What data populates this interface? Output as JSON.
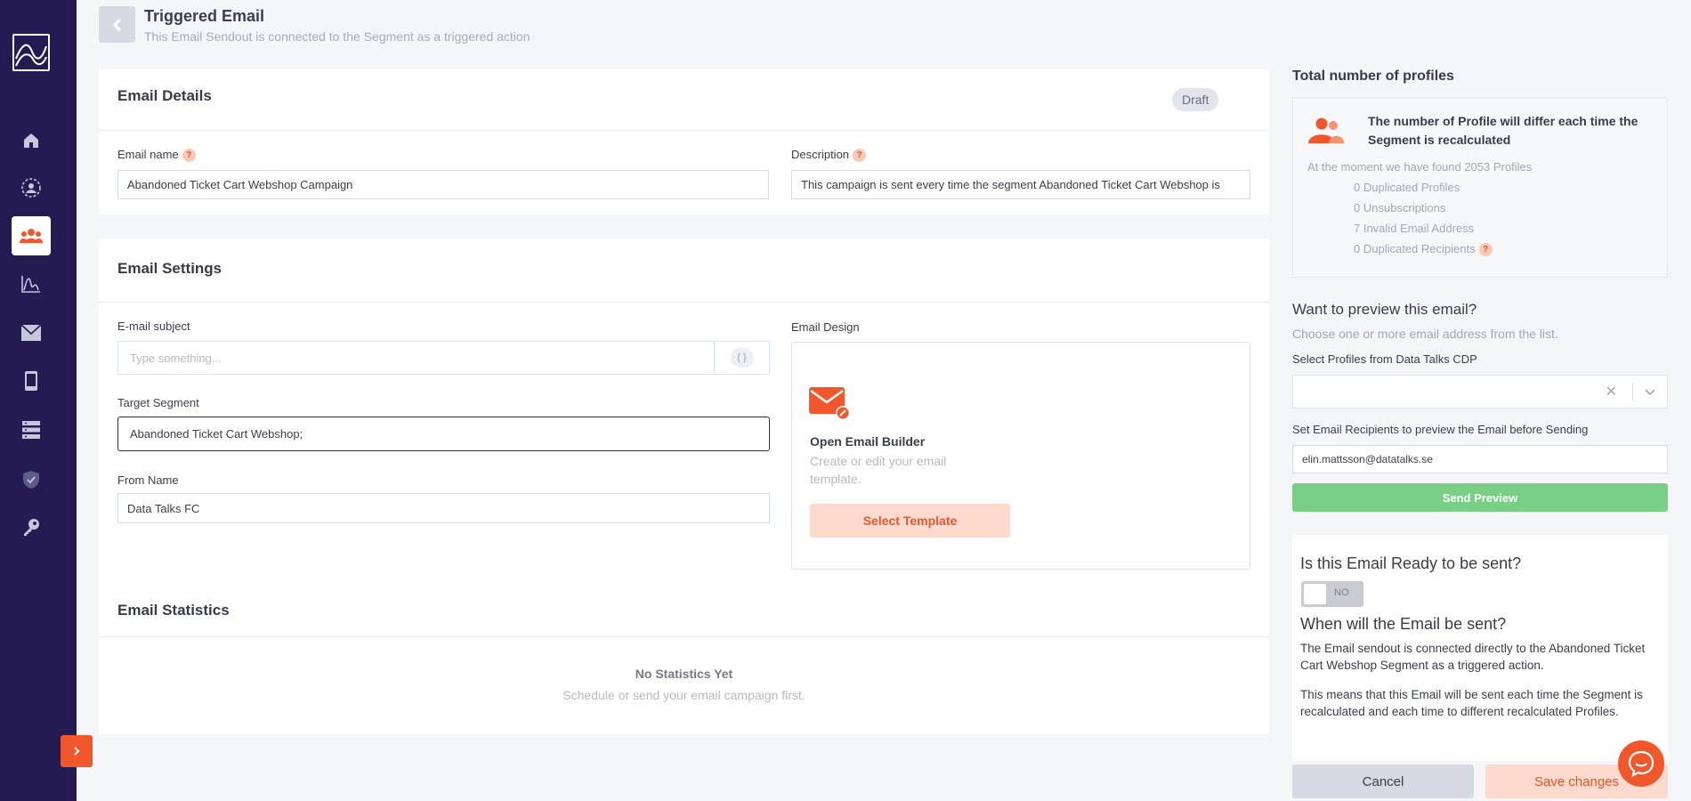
{
  "header": {
    "title": "Triggered Email",
    "subtitle": "This Email Sendout is connected to the Segment as a triggered action"
  },
  "sidebar": {
    "items": [
      {
        "icon": "home-icon"
      },
      {
        "icon": "user-circle-icon"
      },
      {
        "icon": "users-icon"
      },
      {
        "icon": "chart-icon"
      },
      {
        "icon": "email-icon"
      },
      {
        "icon": "mobile-icon"
      },
      {
        "icon": "server-icon"
      },
      {
        "icon": "shield-icon"
      },
      {
        "icon": "key-icon"
      }
    ]
  },
  "email_details": {
    "title": "Email Details",
    "status_badge": "Draft",
    "name_label": "Email name",
    "name_value": "Abandoned Ticket Cart Webshop Campaign",
    "description_label": "Description",
    "description_value": "This campaign is sent every time the segment Abandoned Ticket Cart Webshop is"
  },
  "email_settings": {
    "title": "Email Settings",
    "subject_label": "E-mail subject",
    "subject_placeholder": "Type something...",
    "subject_vars": "{ }",
    "target_label": "Target Segment",
    "target_value": "Abandoned Ticket Cart Webshop;",
    "from_label": "From Name",
    "from_value": "Data Talks FC",
    "design_label": "Email Design",
    "builder_title": "Open Email Builder",
    "builder_text": "Create or edit your email template.",
    "select_template": "Select Template"
  },
  "email_statistics": {
    "title": "Email Statistics",
    "empty_title": "No Statistics Yet",
    "empty_text": "Schedule or send your email campaign first."
  },
  "profiles": {
    "title": "Total number of profiles",
    "notice": "The number of Profile will differ each time the Segment is recalculated",
    "found": "At the moment we have found 2053 Profiles",
    "duplicated": "0 Duplicated Profiles",
    "unsubscriptions": "0 Unsubscriptions",
    "invalid": "7 Invalid Email Address",
    "duplicated_recipients": "0 Duplicated Recipients"
  },
  "preview": {
    "title": "Want to preview this email?",
    "subtitle": "Choose one or more email address from the list.",
    "select_label": "Select Profiles from Data Talks CDP",
    "recipients_label": "Set Email Recipients to preview the Email before Sending",
    "recipients_value": "elin.mattsson@datatalks.se",
    "send_button": "Send Preview"
  },
  "ready": {
    "title": "Is this Email Ready to be sent?",
    "toggle_label": "NO",
    "when_title": "When will the Email be sent?",
    "para1": "The Email sendout is connected directly to the Abandoned Ticket Cart Webshop Segment as a triggered action.",
    "para2": "This means that this Email will be sent each time the Segment is recalculated and each time to different recalculated Profiles."
  },
  "footer": {
    "cancel": "Cancel",
    "save": "Save changes"
  },
  "colors": {
    "sidebar": "#241b52",
    "accent": "#f2572c",
    "success": "#79cf86"
  }
}
